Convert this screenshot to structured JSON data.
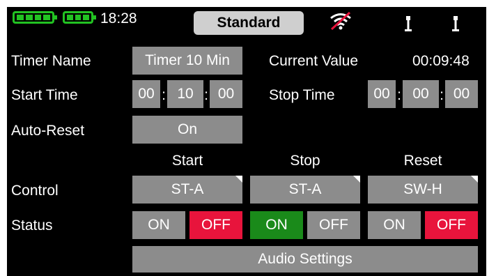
{
  "status_bar": {
    "time": "18:28",
    "mode_tab": "Standard",
    "icons": [
      "battery-icon",
      "battery-icon",
      "signal-muted-icon",
      "antenna-icon",
      "antenna-icon"
    ],
    "battery_color": "#22c322"
  },
  "timer": {
    "name_label": "Timer Name",
    "name_value": "Timer 10 Min",
    "current_label": "Current Value",
    "current_value": "00:09:48",
    "start_label": "Start Time",
    "start_h": "00",
    "start_m": "10",
    "start_s": "00",
    "stop_label": "Stop Time",
    "stop_h": "00",
    "stop_m": "00",
    "stop_s": "00",
    "sep": ":",
    "autoreset_label": "Auto-Reset",
    "autoreset_value": "On"
  },
  "columns": {
    "start": "Start",
    "stop": "Stop",
    "reset": "Reset"
  },
  "control": {
    "label": "Control",
    "start": "ST-A",
    "stop": "ST-A",
    "reset": "SW-H"
  },
  "status": {
    "label": "Status",
    "on": "ON",
    "off": "OFF",
    "active": {
      "start": "OFF",
      "stop": "ON",
      "reset": "OFF"
    }
  },
  "audio_button": "Audio Settings",
  "colors": {
    "button_gray": "#8c8c8c",
    "on_green": "#1a8a1a",
    "off_red": "#e8143c",
    "background": "#000000"
  }
}
